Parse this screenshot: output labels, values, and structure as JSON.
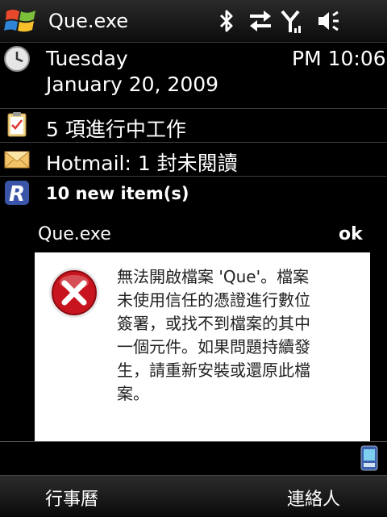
{
  "title_bar": {
    "app_name": "Que.exe",
    "icons": [
      "windows-flag-icon",
      "bluetooth-icon",
      "data-connection-icon",
      "signal-icon",
      "volume-icon"
    ]
  },
  "today": {
    "day": "Tuesday",
    "date": "January 20, 2009",
    "time": "PM 10:06",
    "tasks": "5 項進行中工作",
    "email": "Hotmail: 1 封未閱讀",
    "feed": "10 new item(s)"
  },
  "dialog": {
    "title": "Que.exe",
    "ok_label": "ok",
    "message_lines": [
      "無法開啟檔案 'Que'。檔案",
      "未使用信任的憑證進行數位",
      "簽署，或找不到檔案的其中",
      "一個元件。如果問題持續發",
      "生，請重新安裝或還原此檔",
      "案。"
    ],
    "icon": "error-x-icon"
  },
  "softkeys": {
    "left": "行事曆",
    "right": "連絡人"
  },
  "colors": {
    "background": "#000000",
    "dialog_bg": "#ffffff",
    "error_red": "#c8141e"
  }
}
